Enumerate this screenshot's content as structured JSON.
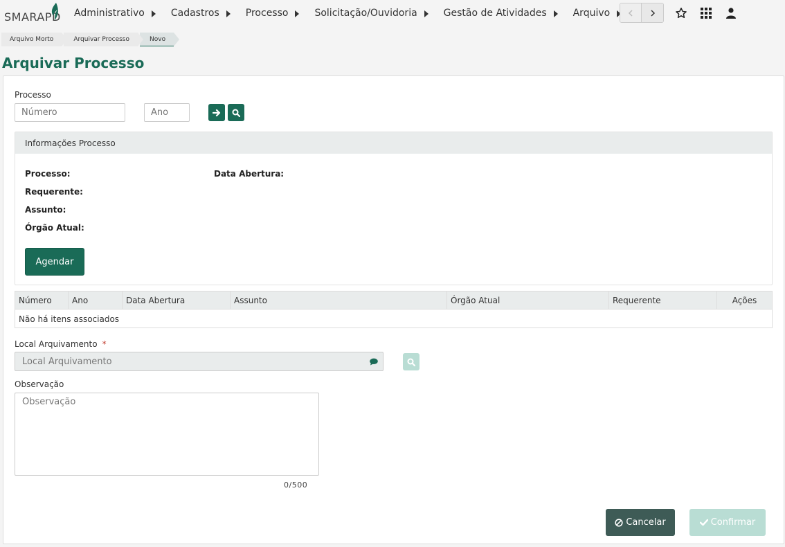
{
  "app": {
    "logo_text": "SMARAPD",
    "brand_color": "#1a6b57"
  },
  "nav": {
    "items": [
      {
        "label": "Administrativo"
      },
      {
        "label": "Cadastros"
      },
      {
        "label": "Processo"
      },
      {
        "label": "Solicitação/Ouvidoria"
      },
      {
        "label": "Gestão de Atividades"
      },
      {
        "label": "Arquivo"
      }
    ],
    "icons": [
      "chevron-left-icon",
      "chevron-right-icon",
      "star-icon",
      "grid-icon",
      "user-icon"
    ]
  },
  "breadcrumb": [
    "Arquivo Morto",
    "Arquivar Processo",
    "Novo"
  ],
  "page_title": "Arquivar Processo",
  "form": {
    "processo_label": "Processo",
    "numero_placeholder": "Número",
    "ano_placeholder": "Ano",
    "info": {
      "title": "Informações Processo",
      "processo_label": "Processo:",
      "requerente_label": "Requerente:",
      "assunto_label": "Assunto:",
      "orgao_label": "Órgão Atual:",
      "data_abertura_label": "Data Abertura:",
      "agendar_label": "Agendar"
    },
    "grid": {
      "columns": [
        "Número",
        "Ano",
        "Data Abertura",
        "Assunto",
        "Órgão Atual",
        "Requerente",
        "Ações"
      ],
      "empty_text": "Não há itens associados"
    },
    "local_label": "Local Arquivamento",
    "local_required": "*",
    "local_placeholder": "Local Arquivamento",
    "obs_label": "Observação",
    "obs_placeholder": "Observação",
    "obs_counter": "0/500",
    "cancel_label": "Cancelar",
    "confirm_label": "Confirmar"
  }
}
